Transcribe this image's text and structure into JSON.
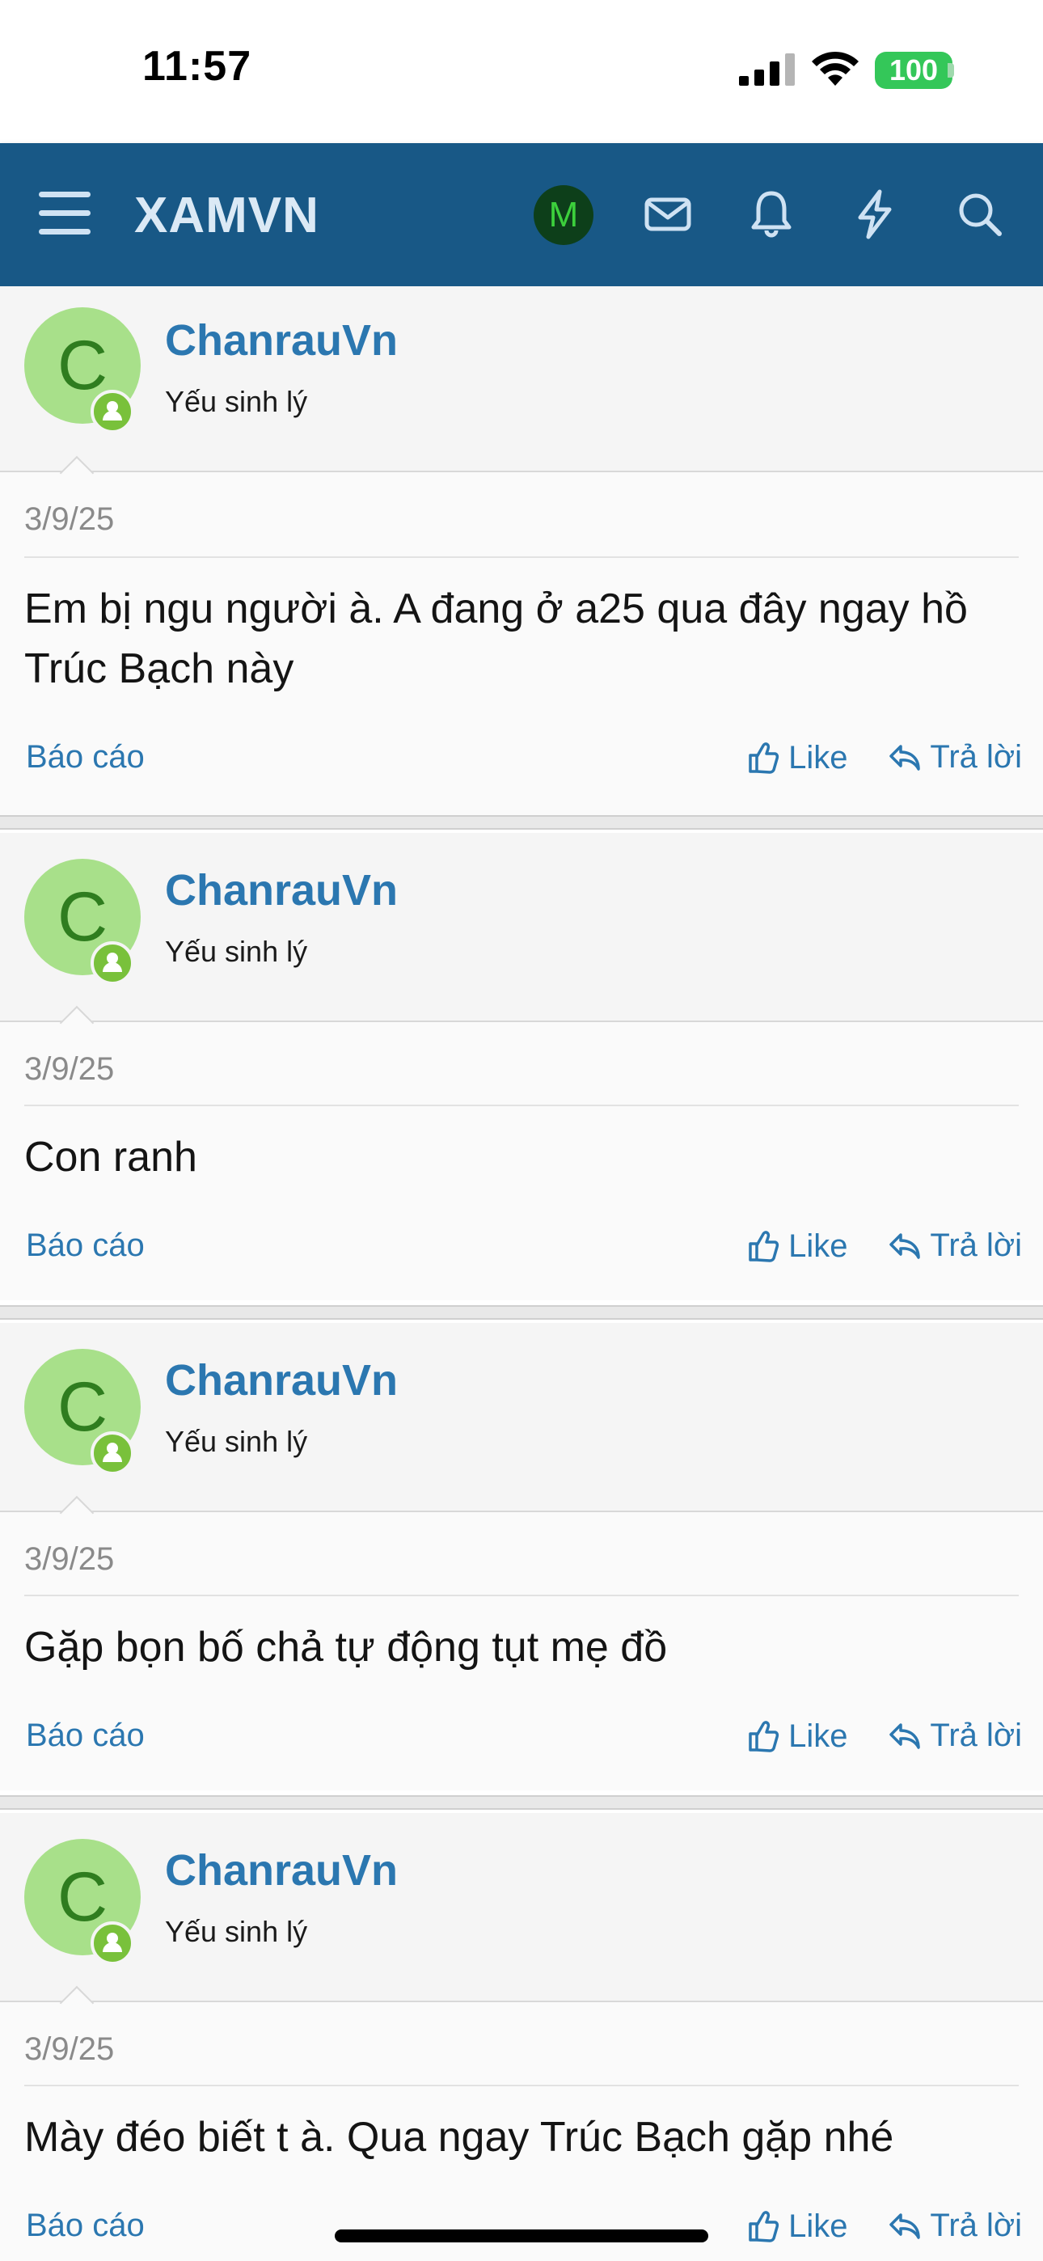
{
  "status_bar": {
    "time": "11:57",
    "battery": "100"
  },
  "navbar": {
    "brand": "XAMVN",
    "avatar_initial": "M"
  },
  "posts": [
    {
      "avatar_initial": "C",
      "username": "ChanrauVn",
      "user_title": "Yếu sinh lý",
      "date": "3/9/25",
      "text": "Em bị ngu người à. A đang ở a25 qua đây ngay hồ Trúc Bạch này",
      "report": "Báo cáo",
      "like": "Like",
      "reply": "Trả lời"
    },
    {
      "avatar_initial": "C",
      "username": "ChanrauVn",
      "user_title": "Yếu sinh lý",
      "date": "3/9/25",
      "text": "Con ranh",
      "report": "Báo cáo",
      "like": "Like",
      "reply": "Trả lời"
    },
    {
      "avatar_initial": "C",
      "username": "ChanrauVn",
      "user_title": "Yếu sinh lý",
      "date": "3/9/25",
      "text": "Gặp bọn bố chả tự động tụt mẹ đồ",
      "report": "Báo cáo",
      "like": "Like",
      "reply": "Trả lời"
    },
    {
      "avatar_initial": "C",
      "username": "ChanrauVn",
      "user_title": "Yếu sinh lý",
      "date": "3/9/25",
      "text": "Mày đéo biết t à. Qua ngay Trúc Bạch gặp nhé",
      "report": "Báo cáo",
      "like": "Like",
      "reply": "Trả lời"
    }
  ],
  "colors": {
    "navbar": "#185886",
    "link": "#2b77b0",
    "avatar_bg": "#a8e08a",
    "badge": "#79c13b"
  }
}
